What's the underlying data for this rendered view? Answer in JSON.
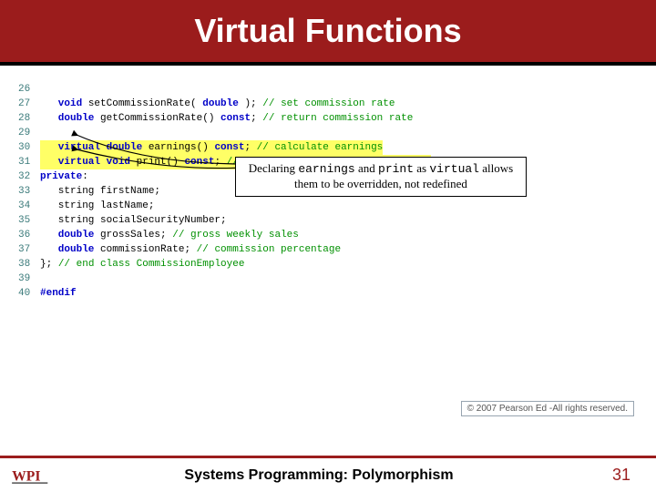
{
  "header": {
    "title": "Virtual Functions"
  },
  "code": {
    "lines": [
      {
        "n": "26",
        "segs": []
      },
      {
        "n": "27",
        "segs": [
          {
            "cls": "kw",
            "t": "   void"
          },
          {
            "cls": "plain",
            "t": " setCommissionRate( "
          },
          {
            "cls": "kw",
            "t": "double"
          },
          {
            "cls": "plain",
            "t": " ); "
          },
          {
            "cls": "cmt",
            "t": "// set commission rate"
          }
        ]
      },
      {
        "n": "28",
        "segs": [
          {
            "cls": "kw",
            "t": "   double"
          },
          {
            "cls": "plain",
            "t": " getCommissionRate() "
          },
          {
            "cls": "kw",
            "t": "const"
          },
          {
            "cls": "plain",
            "t": "; "
          },
          {
            "cls": "cmt",
            "t": "// return commission rate"
          }
        ]
      },
      {
        "n": "29",
        "segs": []
      },
      {
        "n": "30",
        "hl": true,
        "segs": [
          {
            "cls": "kw",
            "t": "   virtual double"
          },
          {
            "cls": "plain",
            "t": " earnings() "
          },
          {
            "cls": "kw",
            "t": "const"
          },
          {
            "cls": "plain",
            "t": "; "
          },
          {
            "cls": "cmt",
            "t": "// calculate earnings"
          }
        ]
      },
      {
        "n": "31",
        "hl": true,
        "segs": [
          {
            "cls": "kw",
            "t": "   virtual void"
          },
          {
            "cls": "plain",
            "t": " print() "
          },
          {
            "cls": "kw",
            "t": "const"
          },
          {
            "cls": "plain",
            "t": "; "
          },
          {
            "cls": "cmt",
            "t": "// print CommissionEmployee object"
          }
        ]
      },
      {
        "n": "32",
        "segs": [
          {
            "cls": "kw2",
            "t": "private"
          },
          {
            "cls": "plain",
            "t": ":"
          }
        ]
      },
      {
        "n": "33",
        "segs": [
          {
            "cls": "plain",
            "t": "   string firstName;"
          }
        ]
      },
      {
        "n": "34",
        "segs": [
          {
            "cls": "plain",
            "t": "   string lastName;"
          }
        ]
      },
      {
        "n": "35",
        "segs": [
          {
            "cls": "plain",
            "t": "   string socialSecurityNumber;"
          }
        ]
      },
      {
        "n": "36",
        "segs": [
          {
            "cls": "kw",
            "t": "   double"
          },
          {
            "cls": "plain",
            "t": " grossSales; "
          },
          {
            "cls": "cmt",
            "t": "// gross weekly sales"
          }
        ]
      },
      {
        "n": "37",
        "segs": [
          {
            "cls": "kw",
            "t": "   double"
          },
          {
            "cls": "plain",
            "t": " commissionRate; "
          },
          {
            "cls": "cmt",
            "t": "// commission percentage"
          }
        ]
      },
      {
        "n": "38",
        "segs": [
          {
            "cls": "plain",
            "t": "}; "
          },
          {
            "cls": "cmt",
            "t": "// end class CommissionEmployee"
          }
        ]
      },
      {
        "n": "39",
        "segs": []
      },
      {
        "n": "40",
        "segs": [
          {
            "cls": "kw2",
            "t": "#endif"
          }
        ]
      }
    ]
  },
  "callout": {
    "pre": "Declaring ",
    "m1": "earnings",
    "mid1": " and ",
    "m2": "print",
    "mid2": " as ",
    "m3": "virtual",
    "post": " allows them to be overridden, not redefined"
  },
  "copyright": "© 2007 Pearson Ed -All rights reserved.",
  "footer": {
    "subtitle": "Systems Programming:  Polymorphism",
    "page": "31",
    "logo_text": "WPI"
  }
}
